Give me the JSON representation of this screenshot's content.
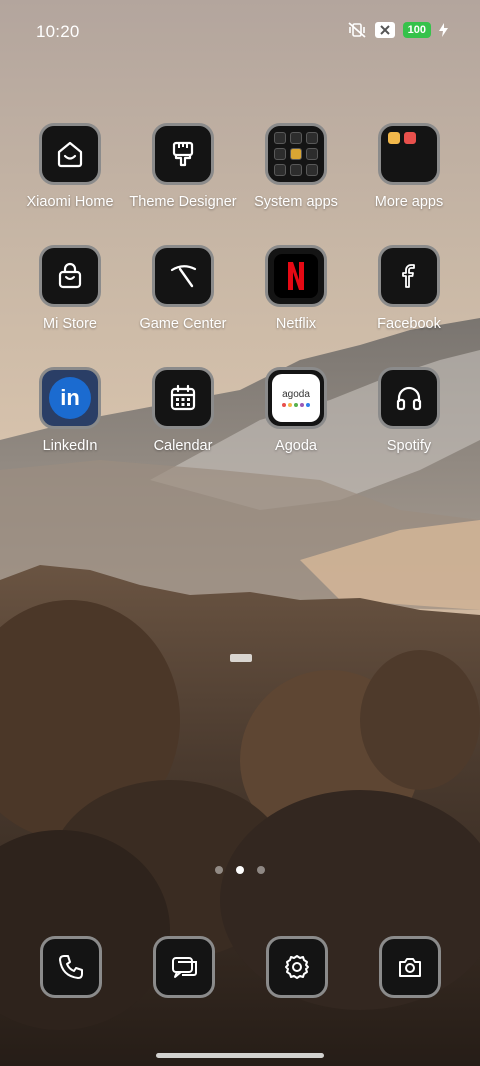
{
  "status_bar": {
    "time": "10:20",
    "battery": "100"
  },
  "apps": [
    {
      "label": "Xiaomi Home",
      "icon": "xiaomi-home-icon"
    },
    {
      "label": "Theme Designer",
      "icon": "theme-brush-icon"
    },
    {
      "label": "System apps",
      "icon": "folder-icon"
    },
    {
      "label": "More apps",
      "icon": "folder-icon"
    },
    {
      "label": "Mi Store",
      "icon": "shopping-bag-icon"
    },
    {
      "label": "Game Center",
      "icon": "pickaxe-icon"
    },
    {
      "label": "Netflix",
      "icon": "netflix-icon"
    },
    {
      "label": "Facebook",
      "icon": "facebook-icon"
    },
    {
      "label": "LinkedIn",
      "icon": "linkedin-icon",
      "glyph": "in"
    },
    {
      "label": "Calendar",
      "icon": "calendar-icon"
    },
    {
      "label": "Agoda",
      "icon": "agoda-icon",
      "wordmark": "agoda"
    },
    {
      "label": "Spotify",
      "icon": "headphones-icon"
    }
  ],
  "page_indicator": {
    "pages": 3,
    "active": 2
  },
  "dock": [
    {
      "name": "phone",
      "icon": "phone-icon"
    },
    {
      "name": "messages",
      "icon": "messages-icon"
    },
    {
      "name": "settings",
      "icon": "gear-icon"
    },
    {
      "name": "camera",
      "icon": "camera-icon"
    }
  ],
  "colors": {
    "battery_green": "#35c24a",
    "netflix_red": "#e50914",
    "linkedin_blue": "#1b6bd0",
    "tile_border": "#8b8b8b"
  }
}
